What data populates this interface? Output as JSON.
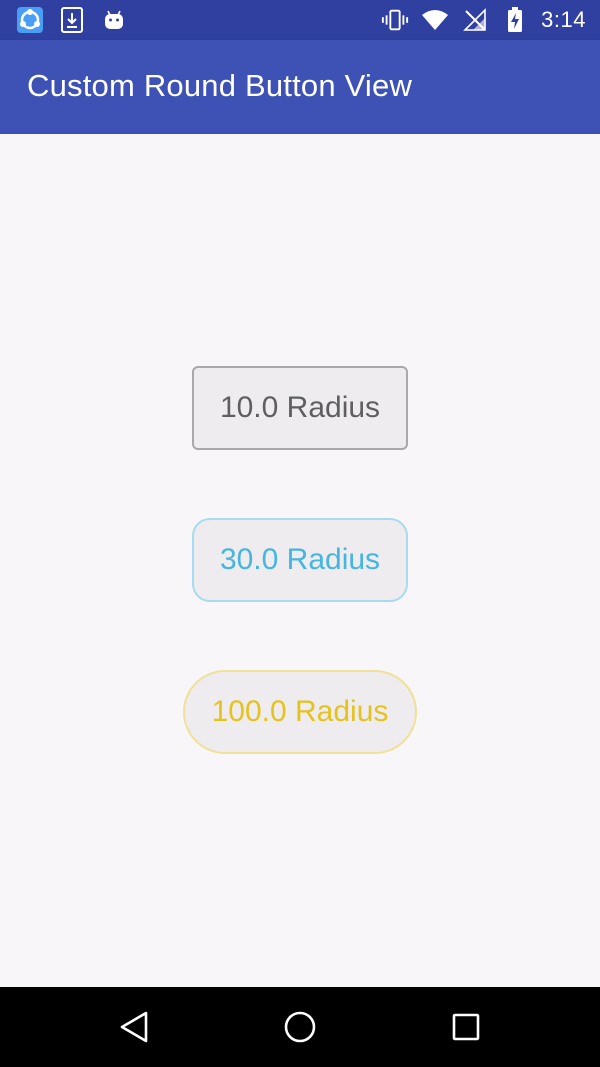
{
  "status_bar": {
    "time": "3:14",
    "left_icons": [
      "shareit-app-icon",
      "download-icon",
      "android-icon"
    ],
    "right_icons": [
      "vibrate-icon",
      "wifi-icon",
      "no-sim-icon",
      "battery-charging-icon"
    ],
    "background": "#3040a0"
  },
  "app_bar": {
    "title": "Custom Round Button View",
    "background": "#3e51b5"
  },
  "buttons": [
    {
      "label": "10.0 Radius",
      "text_color": "#5f5e60",
      "border_color": "#aaa8aa"
    },
    {
      "label": "30.0 Radius",
      "text_color": "#45b6e0",
      "border_color": "#a7dbf1"
    },
    {
      "label": "100.0 Radius",
      "text_color": "#e6c31c",
      "border_color": "#efe197"
    }
  ],
  "nav_bar": {
    "items": [
      "back-icon",
      "home-icon",
      "recent-apps-icon"
    ],
    "background": "#000000"
  }
}
